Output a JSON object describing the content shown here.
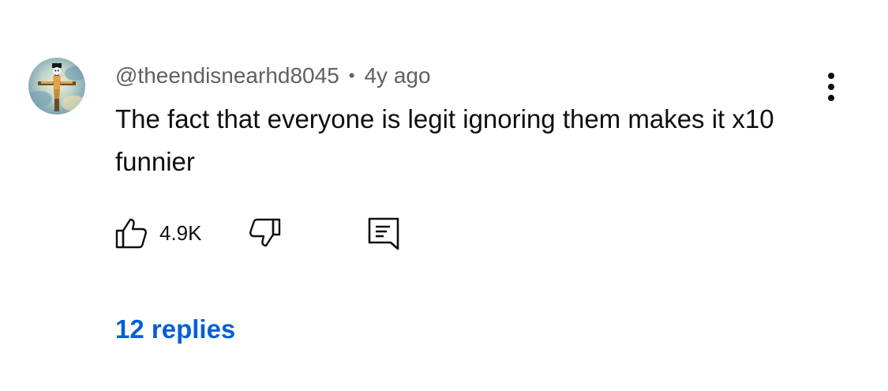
{
  "comment": {
    "author": "@theendisnearhd8045",
    "separator": "•",
    "timestamp": "4y ago",
    "text": "The fact that everyone is legit ignoring them makes it x10 funnier",
    "like_count": "4.9K",
    "replies_label": "12 replies",
    "avatar_icon": "crucifix-avatar",
    "more_icon": "more-vertical-icon",
    "like_icon": "thumbs-up-icon",
    "dislike_icon": "thumbs-down-icon",
    "reply_icon": "reply-comment-icon"
  },
  "colors": {
    "text_primary": "#0f0f0f",
    "text_secondary": "#606060",
    "link": "#065fd4",
    "background": "#ffffff"
  }
}
